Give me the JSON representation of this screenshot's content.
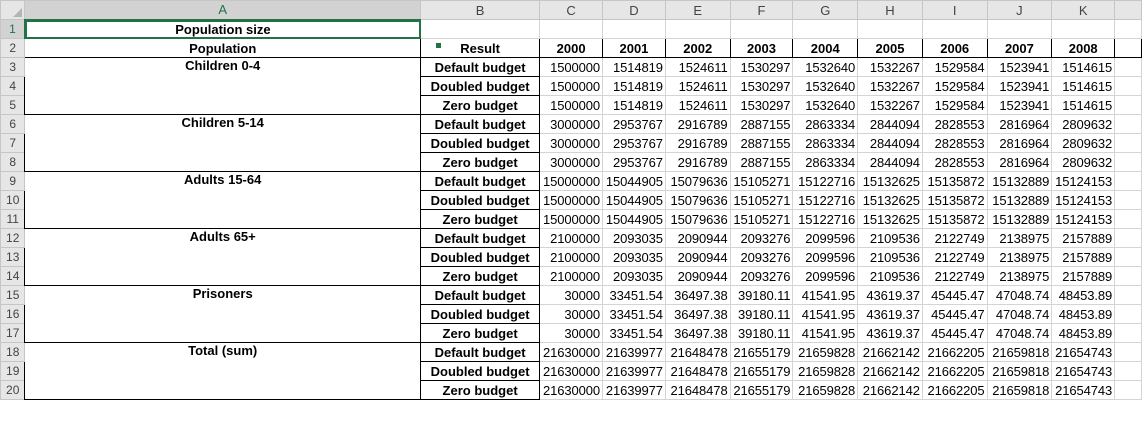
{
  "columns": [
    "A",
    "B",
    "C",
    "D",
    "E",
    "F",
    "G",
    "H",
    "I",
    "J",
    "K"
  ],
  "row_numbers": [
    "1",
    "2",
    "3",
    "4",
    "5",
    "6",
    "7",
    "8",
    "9",
    "10",
    "11",
    "12",
    "13",
    "14",
    "15",
    "16",
    "17",
    "18",
    "19",
    "20"
  ],
  "title": "Population size",
  "headers": {
    "population": "Population",
    "result": "Result",
    "years": [
      "2000",
      "2001",
      "2002",
      "2003",
      "2004",
      "2005",
      "2006",
      "2007",
      "2008"
    ]
  },
  "groups": [
    {
      "name": "Children 0-4",
      "rows": [
        {
          "result": "Default budget",
          "values": [
            "1500000",
            "1514819",
            "1524611",
            "1530297",
            "1532640",
            "1532267",
            "1529584",
            "1523941",
            "1514615"
          ]
        },
        {
          "result": "Doubled budget",
          "values": [
            "1500000",
            "1514819",
            "1524611",
            "1530297",
            "1532640",
            "1532267",
            "1529584",
            "1523941",
            "1514615"
          ]
        },
        {
          "result": "Zero budget",
          "values": [
            "1500000",
            "1514819",
            "1524611",
            "1530297",
            "1532640",
            "1532267",
            "1529584",
            "1523941",
            "1514615"
          ]
        }
      ]
    },
    {
      "name": "Children 5-14",
      "rows": [
        {
          "result": "Default budget",
          "values": [
            "3000000",
            "2953767",
            "2916789",
            "2887155",
            "2863334",
            "2844094",
            "2828553",
            "2816964",
            "2809632"
          ]
        },
        {
          "result": "Doubled budget",
          "values": [
            "3000000",
            "2953767",
            "2916789",
            "2887155",
            "2863334",
            "2844094",
            "2828553",
            "2816964",
            "2809632"
          ]
        },
        {
          "result": "Zero budget",
          "values": [
            "3000000",
            "2953767",
            "2916789",
            "2887155",
            "2863334",
            "2844094",
            "2828553",
            "2816964",
            "2809632"
          ]
        }
      ]
    },
    {
      "name": "Adults 15-64",
      "rows": [
        {
          "result": "Default budget",
          "values": [
            "15000000",
            "15044905",
            "15079636",
            "15105271",
            "15122716",
            "15132625",
            "15135872",
            "15132889",
            "15124153"
          ]
        },
        {
          "result": "Doubled budget",
          "values": [
            "15000000",
            "15044905",
            "15079636",
            "15105271",
            "15122716",
            "15132625",
            "15135872",
            "15132889",
            "15124153"
          ]
        },
        {
          "result": "Zero budget",
          "values": [
            "15000000",
            "15044905",
            "15079636",
            "15105271",
            "15122716",
            "15132625",
            "15135872",
            "15132889",
            "15124153"
          ]
        }
      ]
    },
    {
      "name": "Adults 65+",
      "rows": [
        {
          "result": "Default budget",
          "values": [
            "2100000",
            "2093035",
            "2090944",
            "2093276",
            "2099596",
            "2109536",
            "2122749",
            "2138975",
            "2157889"
          ]
        },
        {
          "result": "Doubled budget",
          "values": [
            "2100000",
            "2093035",
            "2090944",
            "2093276",
            "2099596",
            "2109536",
            "2122749",
            "2138975",
            "2157889"
          ]
        },
        {
          "result": "Zero budget",
          "values": [
            "2100000",
            "2093035",
            "2090944",
            "2093276",
            "2099596",
            "2109536",
            "2122749",
            "2138975",
            "2157889"
          ]
        }
      ]
    },
    {
      "name": "Prisoners",
      "rows": [
        {
          "result": "Default budget",
          "values": [
            "30000",
            "33451.54",
            "36497.38",
            "39180.11",
            "41541.95",
            "43619.37",
            "45445.47",
            "47048.74",
            "48453.89"
          ]
        },
        {
          "result": "Doubled budget",
          "values": [
            "30000",
            "33451.54",
            "36497.38",
            "39180.11",
            "41541.95",
            "43619.37",
            "45445.47",
            "47048.74",
            "48453.89"
          ]
        },
        {
          "result": "Zero budget",
          "values": [
            "30000",
            "33451.54",
            "36497.38",
            "39180.11",
            "41541.95",
            "43619.37",
            "45445.47",
            "47048.74",
            "48453.89"
          ]
        }
      ]
    },
    {
      "name": "Total (sum)",
      "rows": [
        {
          "result": "Default budget",
          "values": [
            "21630000",
            "21639977",
            "21648478",
            "21655179",
            "21659828",
            "21662142",
            "21662205",
            "21659818",
            "21654743"
          ]
        },
        {
          "result": "Doubled budget",
          "values": [
            "21630000",
            "21639977",
            "21648478",
            "21655179",
            "21659828",
            "21662142",
            "21662205",
            "21659818",
            "21654743"
          ]
        },
        {
          "result": "Zero budget",
          "values": [
            "21630000",
            "21639977",
            "21648478",
            "21655179",
            "21659828",
            "21662142",
            "21662205",
            "21659818",
            "21654743"
          ]
        }
      ]
    }
  ],
  "colors": {
    "selection": "#217346",
    "header_bg": "#e6e6e6",
    "gridline": "#d4d4d4"
  }
}
